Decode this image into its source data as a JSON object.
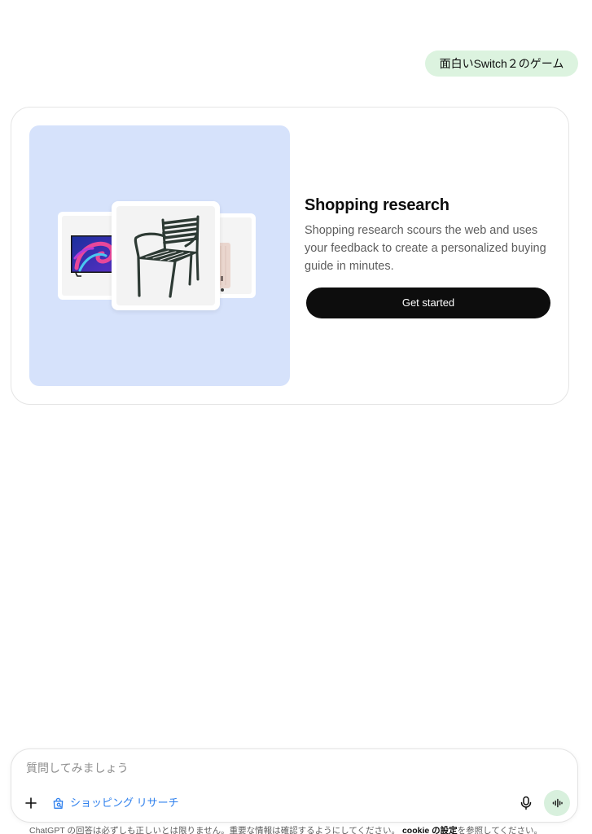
{
  "conversation": {
    "user_message": "面白いSwitch２のゲーム"
  },
  "shopping_card": {
    "title": "Shopping research",
    "description": "Shopping research scours the web and uses your feedback to create a personalized buying guide in minutes.",
    "cta_label": "Get started",
    "products": [
      {
        "icon": "tv-icon"
      },
      {
        "icon": "chair-icon"
      },
      {
        "icon": "luggage-icon"
      }
    ]
  },
  "composer": {
    "placeholder": "質問してみましょう",
    "attach_icon": "plus-icon",
    "tool_chip": {
      "icon": "shopping-bag-search-icon",
      "label": "ショッピング リサーチ"
    },
    "mic_icon": "microphone-icon",
    "voice_icon": "voice-waveform-icon"
  },
  "footer": {
    "disclaimer_prefix": "ChatGPT の回答は必ずしも正しいとは限りません。重要な情報は確認するようにしてください。",
    "cookie_link": "cookie の設定",
    "disclaimer_suffix": "を参照してください。"
  },
  "colors": {
    "user_bubble": "#dcf3df",
    "product_panel": "#d6e2fb",
    "cta_background": "#0d0d0d",
    "tool_chip_accent": "#2f80ed",
    "voice_button": "#d8f0dd"
  }
}
